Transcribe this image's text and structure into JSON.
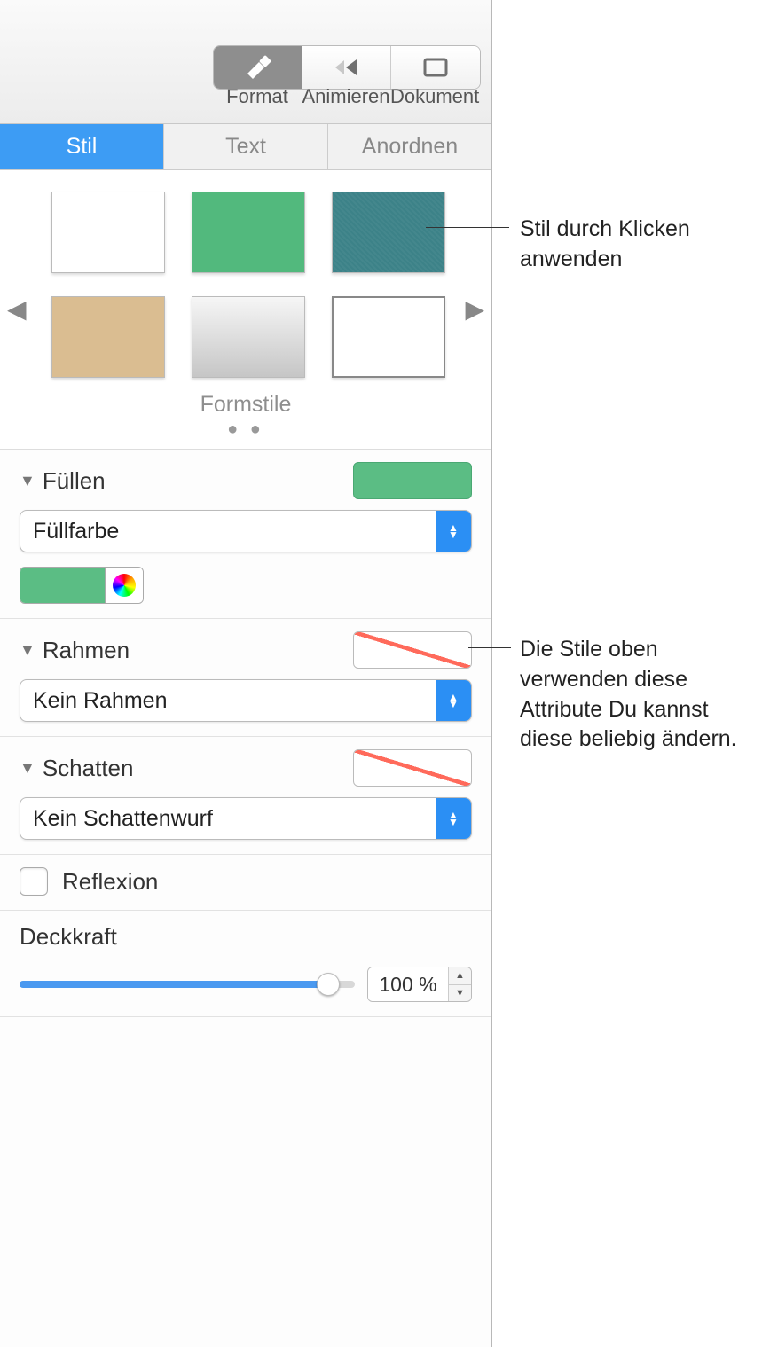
{
  "toolbar": {
    "format": "Format",
    "animate": "Animieren",
    "document": "Dokument"
  },
  "tabs": {
    "style": "Stil",
    "text": "Text",
    "arrange": "Anordnen"
  },
  "styles": {
    "caption": "Formstile"
  },
  "fill": {
    "title": "Füllen",
    "type": "Füllfarbe"
  },
  "border": {
    "title": "Rahmen",
    "type": "Kein Rahmen"
  },
  "shadow": {
    "title": "Schatten",
    "type": "Kein Schattenwurf"
  },
  "reflection": {
    "label": "Reflexion"
  },
  "opacity": {
    "label": "Deckkraft",
    "value": "100 %"
  },
  "callouts": {
    "c1": "Stil durch Klicken anwenden",
    "c2": "Die Stile oben verwenden diese Attribute Du kannst diese beliebig ändern."
  }
}
